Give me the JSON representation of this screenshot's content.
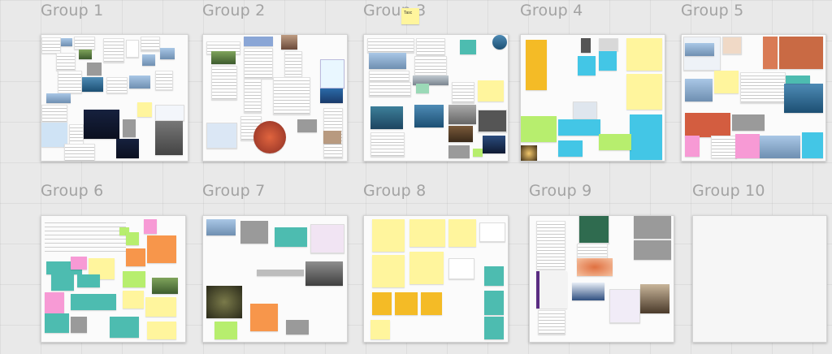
{
  "board": {
    "frames": [
      {
        "title": "Group 1"
      },
      {
        "title": "Group 2"
      },
      {
        "title": "Group 3"
      },
      {
        "title": "Group 4"
      },
      {
        "title": "Group 5"
      },
      {
        "title": "Group 6"
      },
      {
        "title": "Group 7"
      },
      {
        "title": "Group 8"
      },
      {
        "title": "Group 9"
      },
      {
        "title": "Group 10"
      }
    ],
    "floating_note": "Tasc"
  }
}
